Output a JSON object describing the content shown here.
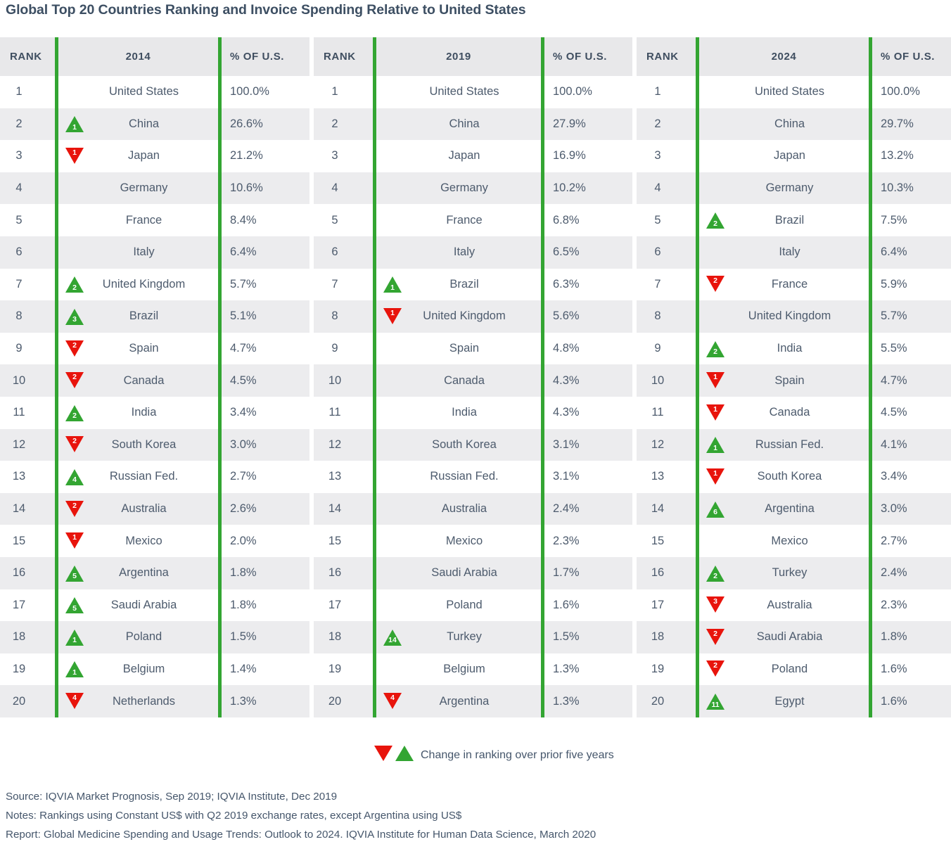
{
  "title": "Global Top 20 Countries Ranking and Invoice Spending Relative to United States",
  "colors": {
    "green": "#33a532",
    "red": "#e8140c",
    "text": "#4d5b6d",
    "header_bg": "#e8e8ea",
    "row_alt_bg": "#ececee"
  },
  "columns": {
    "rank_header": "RANK",
    "pct_header": "% OF U.S."
  },
  "legend": {
    "down_icon": "triangle-down-icon",
    "up_icon": "triangle-up-icon",
    "text": "Change in ranking over prior five years"
  },
  "footer": {
    "lines": [
      "Source: IQVIA Market Prognosis, Sep 2019; IQVIA Institute, Dec 2019",
      "Notes: Rankings using Constant US$ with Q2 2019 exchange rates, except Argentina using US$",
      "Report: Global Medicine Spending and Usage Trends: Outlook to 2024. IQVIA Institute for Human Data Science, March 2020"
    ]
  },
  "chart_data": {
    "type": "table",
    "title": "Global Top 20 Countries Ranking and Invoice Spending Relative to United States",
    "groups": [
      {
        "year": "2014",
        "rows": [
          {
            "rank": "1",
            "country": "United States",
            "pct": "100.0%",
            "change": null
          },
          {
            "rank": "2",
            "country": "China",
            "pct": "26.6%",
            "change": {
              "dir": "up",
              "n": "1"
            }
          },
          {
            "rank": "3",
            "country": "Japan",
            "pct": "21.2%",
            "change": {
              "dir": "down",
              "n": "1"
            }
          },
          {
            "rank": "4",
            "country": "Germany",
            "pct": "10.6%",
            "change": null
          },
          {
            "rank": "5",
            "country": "France",
            "pct": "8.4%",
            "change": null
          },
          {
            "rank": "6",
            "country": "Italy",
            "pct": "6.4%",
            "change": null
          },
          {
            "rank": "7",
            "country": "United Kingdom",
            "pct": "5.7%",
            "change": {
              "dir": "up",
              "n": "2"
            }
          },
          {
            "rank": "8",
            "country": "Brazil",
            "pct": "5.1%",
            "change": {
              "dir": "up",
              "n": "3"
            }
          },
          {
            "rank": "9",
            "country": "Spain",
            "pct": "4.7%",
            "change": {
              "dir": "down",
              "n": "2"
            }
          },
          {
            "rank": "10",
            "country": "Canada",
            "pct": "4.5%",
            "change": {
              "dir": "down",
              "n": "2"
            }
          },
          {
            "rank": "11",
            "country": "India",
            "pct": "3.4%",
            "change": {
              "dir": "up",
              "n": "2"
            }
          },
          {
            "rank": "12",
            "country": "South Korea",
            "pct": "3.0%",
            "change": {
              "dir": "down",
              "n": "2"
            }
          },
          {
            "rank": "13",
            "country": "Russian Fed.",
            "pct": "2.7%",
            "change": {
              "dir": "up",
              "n": "4"
            }
          },
          {
            "rank": "14",
            "country": "Australia",
            "pct": "2.6%",
            "change": {
              "dir": "down",
              "n": "2"
            }
          },
          {
            "rank": "15",
            "country": "Mexico",
            "pct": "2.0%",
            "change": {
              "dir": "down",
              "n": "1"
            }
          },
          {
            "rank": "16",
            "country": "Argentina",
            "pct": "1.8%",
            "change": {
              "dir": "up",
              "n": "5"
            }
          },
          {
            "rank": "17",
            "country": "Saudi Arabia",
            "pct": "1.8%",
            "change": {
              "dir": "up",
              "n": "5"
            }
          },
          {
            "rank": "18",
            "country": "Poland",
            "pct": "1.5%",
            "change": {
              "dir": "up",
              "n": "1"
            }
          },
          {
            "rank": "19",
            "country": "Belgium",
            "pct": "1.4%",
            "change": {
              "dir": "up",
              "n": "1"
            }
          },
          {
            "rank": "20",
            "country": "Netherlands",
            "pct": "1.3%",
            "change": {
              "dir": "down",
              "n": "4"
            }
          }
        ]
      },
      {
        "year": "2019",
        "rows": [
          {
            "rank": "1",
            "country": "United States",
            "pct": "100.0%",
            "change": null
          },
          {
            "rank": "2",
            "country": "China",
            "pct": "27.9%",
            "change": null
          },
          {
            "rank": "3",
            "country": "Japan",
            "pct": "16.9%",
            "change": null
          },
          {
            "rank": "4",
            "country": "Germany",
            "pct": "10.2%",
            "change": null
          },
          {
            "rank": "5",
            "country": "France",
            "pct": "6.8%",
            "change": null
          },
          {
            "rank": "6",
            "country": "Italy",
            "pct": "6.5%",
            "change": null
          },
          {
            "rank": "7",
            "country": "Brazil",
            "pct": "6.3%",
            "change": {
              "dir": "up",
              "n": "1"
            }
          },
          {
            "rank": "8",
            "country": "United Kingdom",
            "pct": "5.6%",
            "change": {
              "dir": "down",
              "n": "1"
            }
          },
          {
            "rank": "9",
            "country": "Spain",
            "pct": "4.8%",
            "change": null
          },
          {
            "rank": "10",
            "country": "Canada",
            "pct": "4.3%",
            "change": null
          },
          {
            "rank": "11",
            "country": "India",
            "pct": "4.3%",
            "change": null
          },
          {
            "rank": "12",
            "country": "South Korea",
            "pct": "3.1%",
            "change": null
          },
          {
            "rank": "13",
            "country": "Russian Fed.",
            "pct": "3.1%",
            "change": null
          },
          {
            "rank": "14",
            "country": "Australia",
            "pct": "2.4%",
            "change": null
          },
          {
            "rank": "15",
            "country": "Mexico",
            "pct": "2.3%",
            "change": null
          },
          {
            "rank": "16",
            "country": "Saudi Arabia",
            "pct": "1.7%",
            "change": null
          },
          {
            "rank": "17",
            "country": "Poland",
            "pct": "1.6%",
            "change": null
          },
          {
            "rank": "18",
            "country": "Turkey",
            "pct": "1.5%",
            "change": {
              "dir": "up",
              "n": "14"
            }
          },
          {
            "rank": "19",
            "country": "Belgium",
            "pct": "1.3%",
            "change": null
          },
          {
            "rank": "20",
            "country": "Argentina",
            "pct": "1.3%",
            "change": {
              "dir": "down",
              "n": "4"
            }
          }
        ]
      },
      {
        "year": "2024",
        "rows": [
          {
            "rank": "1",
            "country": "United States",
            "pct": "100.0%",
            "change": null
          },
          {
            "rank": "2",
            "country": "China",
            "pct": "29.7%",
            "change": null
          },
          {
            "rank": "3",
            "country": "Japan",
            "pct": "13.2%",
            "change": null
          },
          {
            "rank": "4",
            "country": "Germany",
            "pct": "10.3%",
            "change": null
          },
          {
            "rank": "5",
            "country": "Brazil",
            "pct": "7.5%",
            "change": {
              "dir": "up",
              "n": "2"
            }
          },
          {
            "rank": "6",
            "country": "Italy",
            "pct": "6.4%",
            "change": null
          },
          {
            "rank": "7",
            "country": "France",
            "pct": "5.9%",
            "change": {
              "dir": "down",
              "n": "2"
            }
          },
          {
            "rank": "8",
            "country": "United Kingdom",
            "pct": "5.7%",
            "change": null
          },
          {
            "rank": "9",
            "country": "India",
            "pct": "5.5%",
            "change": {
              "dir": "up",
              "n": "2"
            }
          },
          {
            "rank": "10",
            "country": "Spain",
            "pct": "4.7%",
            "change": {
              "dir": "down",
              "n": "1"
            }
          },
          {
            "rank": "11",
            "country": "Canada",
            "pct": "4.5%",
            "change": {
              "dir": "down",
              "n": "1"
            }
          },
          {
            "rank": "12",
            "country": "Russian Fed.",
            "pct": "4.1%",
            "change": {
              "dir": "up",
              "n": "1"
            }
          },
          {
            "rank": "13",
            "country": "South Korea",
            "pct": "3.4%",
            "change": {
              "dir": "down",
              "n": "1"
            }
          },
          {
            "rank": "14",
            "country": "Argentina",
            "pct": "3.0%",
            "change": {
              "dir": "up",
              "n": "6"
            }
          },
          {
            "rank": "15",
            "country": "Mexico",
            "pct": "2.7%",
            "change": null
          },
          {
            "rank": "16",
            "country": "Turkey",
            "pct": "2.4%",
            "change": {
              "dir": "up",
              "n": "2"
            }
          },
          {
            "rank": "17",
            "country": "Australia",
            "pct": "2.3%",
            "change": {
              "dir": "down",
              "n": "3"
            }
          },
          {
            "rank": "18",
            "country": "Saudi Arabia",
            "pct": "1.8%",
            "change": {
              "dir": "down",
              "n": "2"
            }
          },
          {
            "rank": "19",
            "country": "Poland",
            "pct": "1.6%",
            "change": {
              "dir": "down",
              "n": "2"
            }
          },
          {
            "rank": "20",
            "country": "Egypt",
            "pct": "1.6%",
            "change": {
              "dir": "up",
              "n": "11"
            }
          }
        ]
      }
    ]
  }
}
